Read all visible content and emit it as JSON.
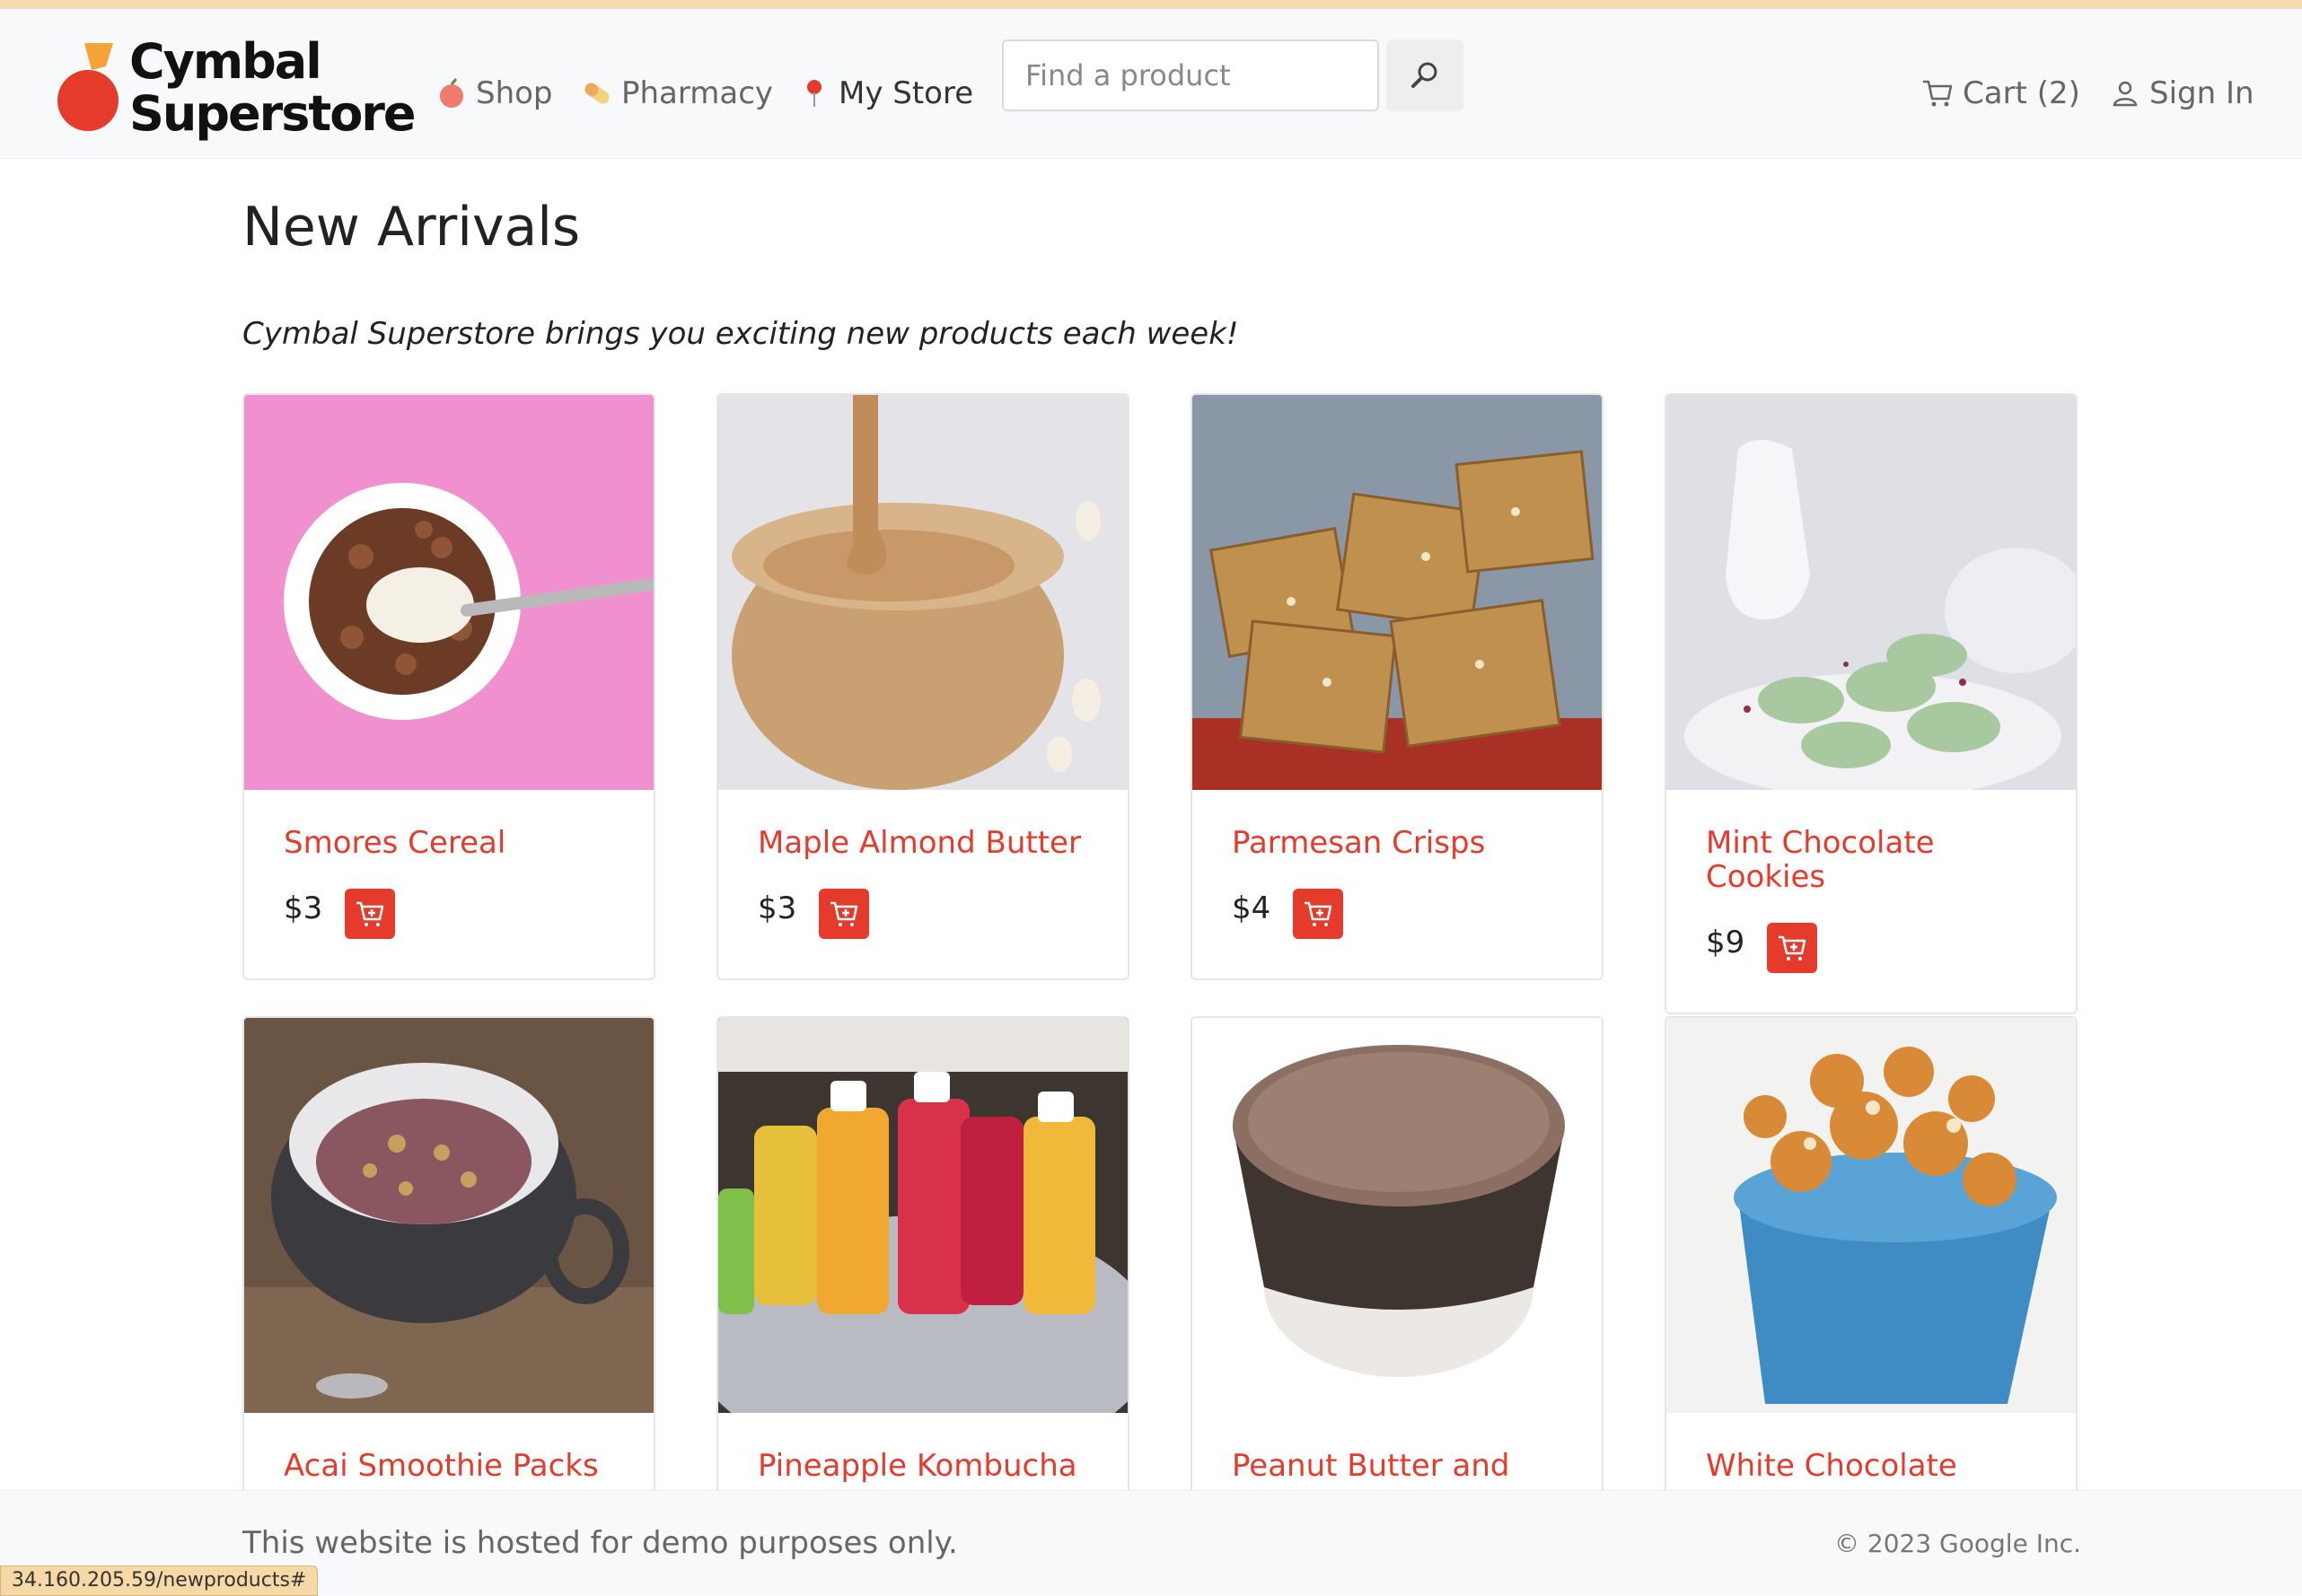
{
  "brand": {
    "line1": "Cymbal",
    "line2": "Superstore"
  },
  "nav": {
    "shop": "Shop",
    "pharmacy": "Pharmacy",
    "my_store": "My Store"
  },
  "search": {
    "placeholder": "Find a product"
  },
  "header_actions": {
    "cart": "Cart (2)",
    "sign_in": "Sign In"
  },
  "page": {
    "title": "New Arrivals",
    "intro": "Cymbal Superstore brings you exciting new products each week!"
  },
  "products": [
    {
      "name": "Smores Cereal",
      "price": "$3"
    },
    {
      "name": "Maple Almond Butter",
      "price": "$3"
    },
    {
      "name": "Parmesan Crisps",
      "price": "$4"
    },
    {
      "name": "Mint Chocolate Cookies",
      "price": "$9"
    },
    {
      "name": "Acai Smoothie Packs"
    },
    {
      "name": "Pineapple Kombucha"
    },
    {
      "name": "Peanut Butter and"
    },
    {
      "name": "White Chocolate"
    }
  ],
  "footer": {
    "disclaimer": "This website is hosted for demo purposes only.",
    "copyright": "© 2023 Google Inc."
  },
  "status_bar": {
    "url": "34.160.205.59/newproducts#"
  },
  "colors": {
    "accent": "#e53b2c",
    "header_bg": "#f8f9fa"
  }
}
